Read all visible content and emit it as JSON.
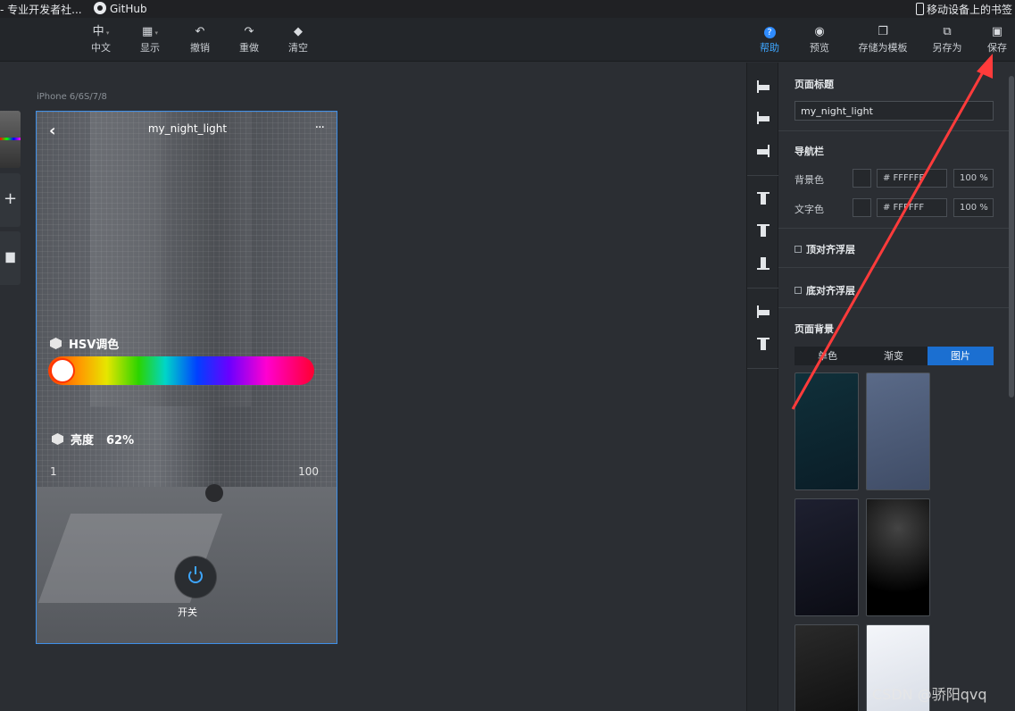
{
  "bookmarks": {
    "left_item": "- 专业开发者社...",
    "github": "GitHub",
    "mobile_bookmarks": "移动设备上的书签"
  },
  "toolbar": {
    "lang_icon": "中",
    "lang": "中文",
    "display": "显示",
    "undo": "撤销",
    "redo": "重做",
    "clear": "清空",
    "help": "帮助",
    "preview": "预览",
    "save_template": "存储为模板",
    "save_as": "另存为",
    "save": "保存",
    "accent": "#3ea6ff"
  },
  "canvas": {
    "device_label": "iPhone 6/6S/7/8",
    "page": {
      "back_glyph": "‹",
      "title": "my_night_light",
      "more_glyph": "···",
      "hsv_label": "HSV调色",
      "brightness_label": "亮度",
      "brightness_value": "62%",
      "slider_min": "1",
      "slider_max": "100",
      "switch_label": "开关"
    }
  },
  "panel": {
    "page_title_section": "页面标题",
    "page_title_value": "my_night_light",
    "navbar_section": "导航栏",
    "bg_color_label": "背景色",
    "bg_color_hex": "#  FFFFFF",
    "bg_color_opacity": "100  %",
    "text_color_label": "文字色",
    "text_color_hex": "#  FFFFFF",
    "text_color_opacity": "100  %",
    "top_float": "顶对齐浮层",
    "bottom_float": "底对齐浮层",
    "page_bg_section": "页面背景",
    "bg_tabs": [
      "单色",
      "渐变",
      "图片"
    ],
    "bg_tab_selected": "图片"
  },
  "watermark": "CSDN @骄阳qvq"
}
